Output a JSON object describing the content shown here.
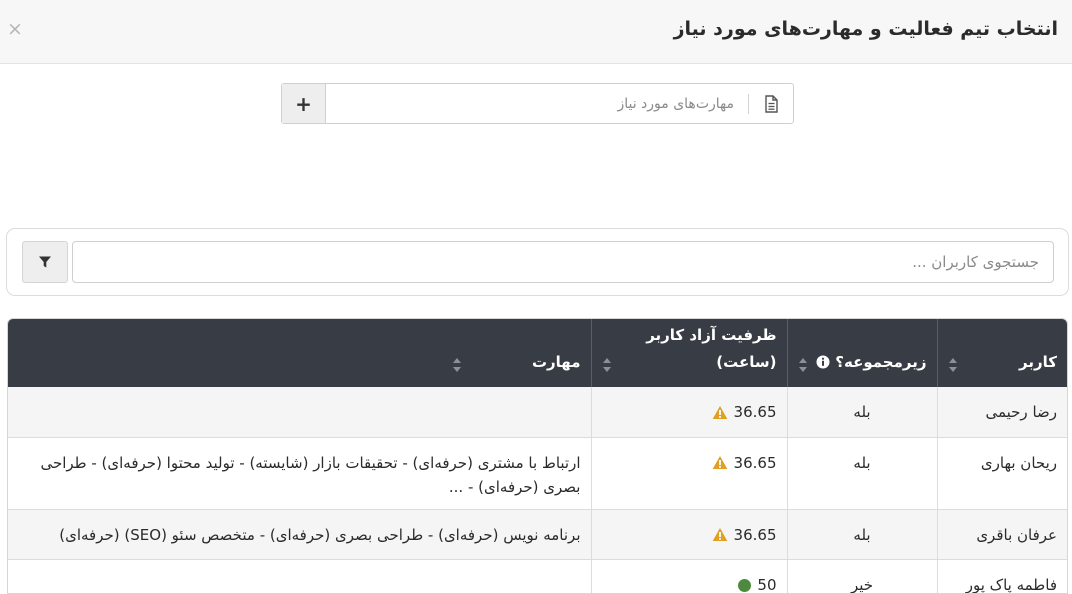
{
  "modal": {
    "title": "انتخاب تیم فعالیت و مهارت‌های مورد نیاز",
    "close_label": "×"
  },
  "skills": {
    "placeholder": "مهارت‌های مورد نیاز",
    "add_label": "+"
  },
  "search": {
    "placeholder": "جستجوی کاربران ..."
  },
  "table": {
    "headers": {
      "user": "کاربر",
      "subset": "زیرمجموعه؟",
      "capacity_line1": "ظرفیت آزاد کاربر",
      "capacity_line2": "(ساعت)",
      "skill": "مهارت"
    },
    "rows": [
      {
        "user": "رضا رحیمی",
        "subset": "بله",
        "capacity": "36.65",
        "status": "warning",
        "skill": ""
      },
      {
        "user": "ریحان بهاری",
        "subset": "بله",
        "capacity": "36.65",
        "status": "warning",
        "skill": "ارتباط با مشتری (حرفه‌ای) - تحقیقات بازار (شایسته) - تولید محتوا (حرفه‌ای) - طراحی بصری (حرفه‌ای) - ..."
      },
      {
        "user": "عرفان باقری",
        "subset": "بله",
        "capacity": "36.65",
        "status": "warning",
        "skill": "برنامه نویس (حرفه‌ای) - طراحی بصری (حرفه‌ای) - متخصص سئو (SEO) (حرفه‌ای)"
      },
      {
        "user": "فاطمه پاک پور",
        "subset": "خیر",
        "capacity": "50",
        "status": "ok",
        "skill": ""
      }
    ]
  },
  "colors": {
    "header_bg": "#383c44",
    "warning": "#e0a020",
    "ok": "#4e8a3e"
  }
}
